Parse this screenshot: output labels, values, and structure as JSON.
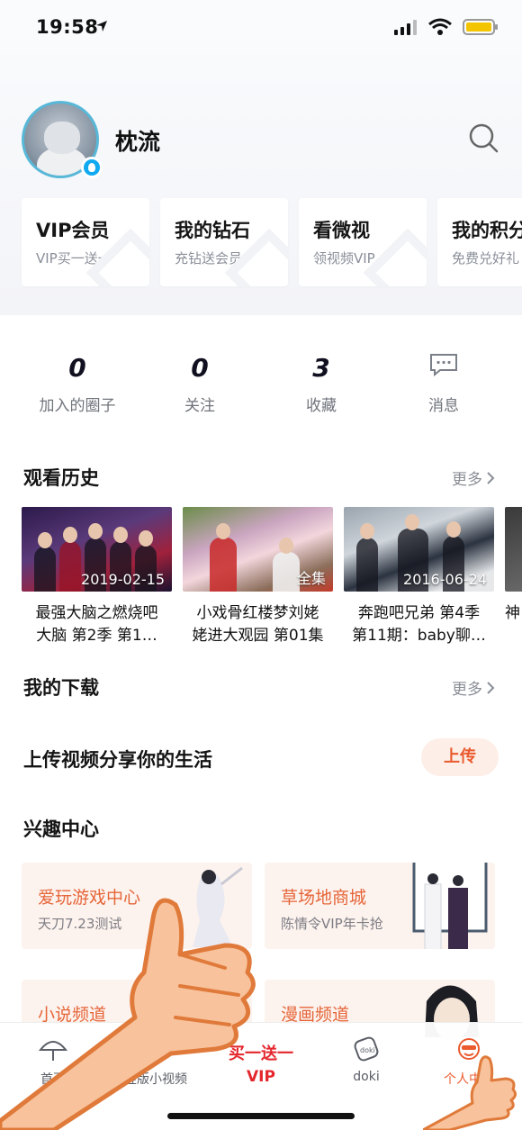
{
  "status_bar": {
    "time": "19:58"
  },
  "profile": {
    "username": "枕流"
  },
  "cards": [
    {
      "title": "VIP会员",
      "subtitle": "VIP买一送一"
    },
    {
      "title": "我的钻石",
      "subtitle": "充钻送会员"
    },
    {
      "title": "看微视",
      "subtitle": "领视频VIP"
    },
    {
      "title": "我的积分",
      "subtitle": "免费兑好礼"
    }
  ],
  "stats": [
    {
      "value": "0",
      "label": "加入的圈子"
    },
    {
      "value": "0",
      "label": "关注"
    },
    {
      "value": "3",
      "label": "收藏"
    },
    {
      "value": "",
      "label": "消息"
    }
  ],
  "history": {
    "title": "观看历史",
    "more": "更多",
    "items": [
      {
        "date": "2019-02-15",
        "caption_line1": "最强大脑之燃烧吧",
        "caption_line2": "大脑 第2季 第1…"
      },
      {
        "date": "",
        "badge": "全集",
        "caption_line1": "小戏骨红楼梦刘姥",
        "caption_line2": "姥进大观园 第01集"
      },
      {
        "date": "2016-06-24",
        "caption_line1": "奔跑吧兄弟 第4季",
        "caption_line2": "第11期：baby聊…"
      },
      {
        "date": "",
        "caption_line1": "神",
        "caption_line2": ""
      }
    ]
  },
  "downloads": {
    "title": "我的下载",
    "more": "更多"
  },
  "upload": {
    "title": "上传视频分享你的生活",
    "button": "上传"
  },
  "interest": {
    "title": "兴趣中心",
    "cards": [
      {
        "title": "爱玩游戏中心",
        "subtitle": "天刀7.23测试"
      },
      {
        "title": "草场地商城",
        "subtitle": "陈情令VIP年卡抢"
      },
      {
        "title": "小说频道",
        "subtitle": ""
      },
      {
        "title": "漫画频道",
        "subtitle": ""
      }
    ]
  },
  "tab_bar": {
    "home": "首页",
    "video": "竖版小视频",
    "promo_line1": "买一送一",
    "promo_line2": "VIP",
    "doki": "doki",
    "me": "个人中心"
  },
  "colors": {
    "accent": "#ea5a2e",
    "promo": "#e4262d",
    "interest_bg": "#fdf3ee"
  }
}
